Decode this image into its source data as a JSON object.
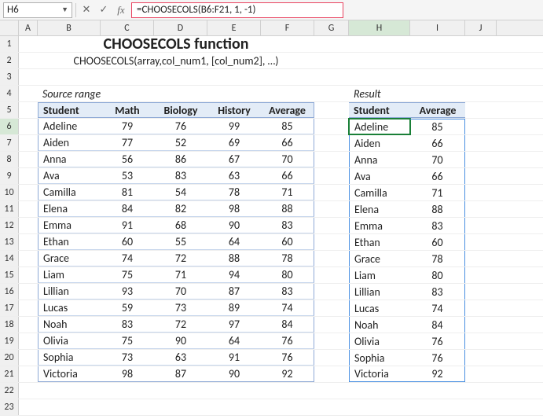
{
  "formula_bar": {
    "name_box": "H6",
    "formula": "=CHOOSECOLS(B6:F21, 1, -1)",
    "fx_label": "fx"
  },
  "columns": [
    "A",
    "B",
    "C",
    "D",
    "E",
    "F",
    "G",
    "H",
    "I",
    "J"
  ],
  "active_col": "H",
  "active_row": "6",
  "title": "CHOOSECOLS function",
  "subtitle": "CHOOSECOLS(array,col_num1, [col_num2], …)",
  "labels": {
    "source": "Source range",
    "result": "Result"
  },
  "source_headers": [
    "Student",
    "Math",
    "Biology",
    "History",
    "Average"
  ],
  "result_headers": [
    "Student",
    "Average"
  ],
  "chart_data": {
    "type": "table",
    "columns": [
      "Student",
      "Math",
      "Biology",
      "History",
      "Average"
    ],
    "rows": [
      [
        "Adeline",
        79,
        76,
        99,
        85
      ],
      [
        "Aiden",
        77,
        52,
        69,
        66
      ],
      [
        "Anna",
        56,
        86,
        67,
        70
      ],
      [
        "Ava",
        53,
        83,
        63,
        66
      ],
      [
        "Camilla",
        81,
        54,
        78,
        71
      ],
      [
        "Elena",
        84,
        82,
        98,
        88
      ],
      [
        "Emma",
        91,
        68,
        90,
        83
      ],
      [
        "Ethan",
        60,
        55,
        64,
        60
      ],
      [
        "Grace",
        74,
        72,
        88,
        78
      ],
      [
        "Liam",
        75,
        71,
        94,
        80
      ],
      [
        "Lillian",
        93,
        70,
        87,
        83
      ],
      [
        "Lucas",
        59,
        73,
        89,
        74
      ],
      [
        "Noah",
        83,
        72,
        97,
        84
      ],
      [
        "Olivia",
        75,
        90,
        64,
        76
      ],
      [
        "Sophia",
        73,
        63,
        91,
        76
      ],
      [
        "Victoria",
        98,
        87,
        90,
        92
      ]
    ]
  }
}
